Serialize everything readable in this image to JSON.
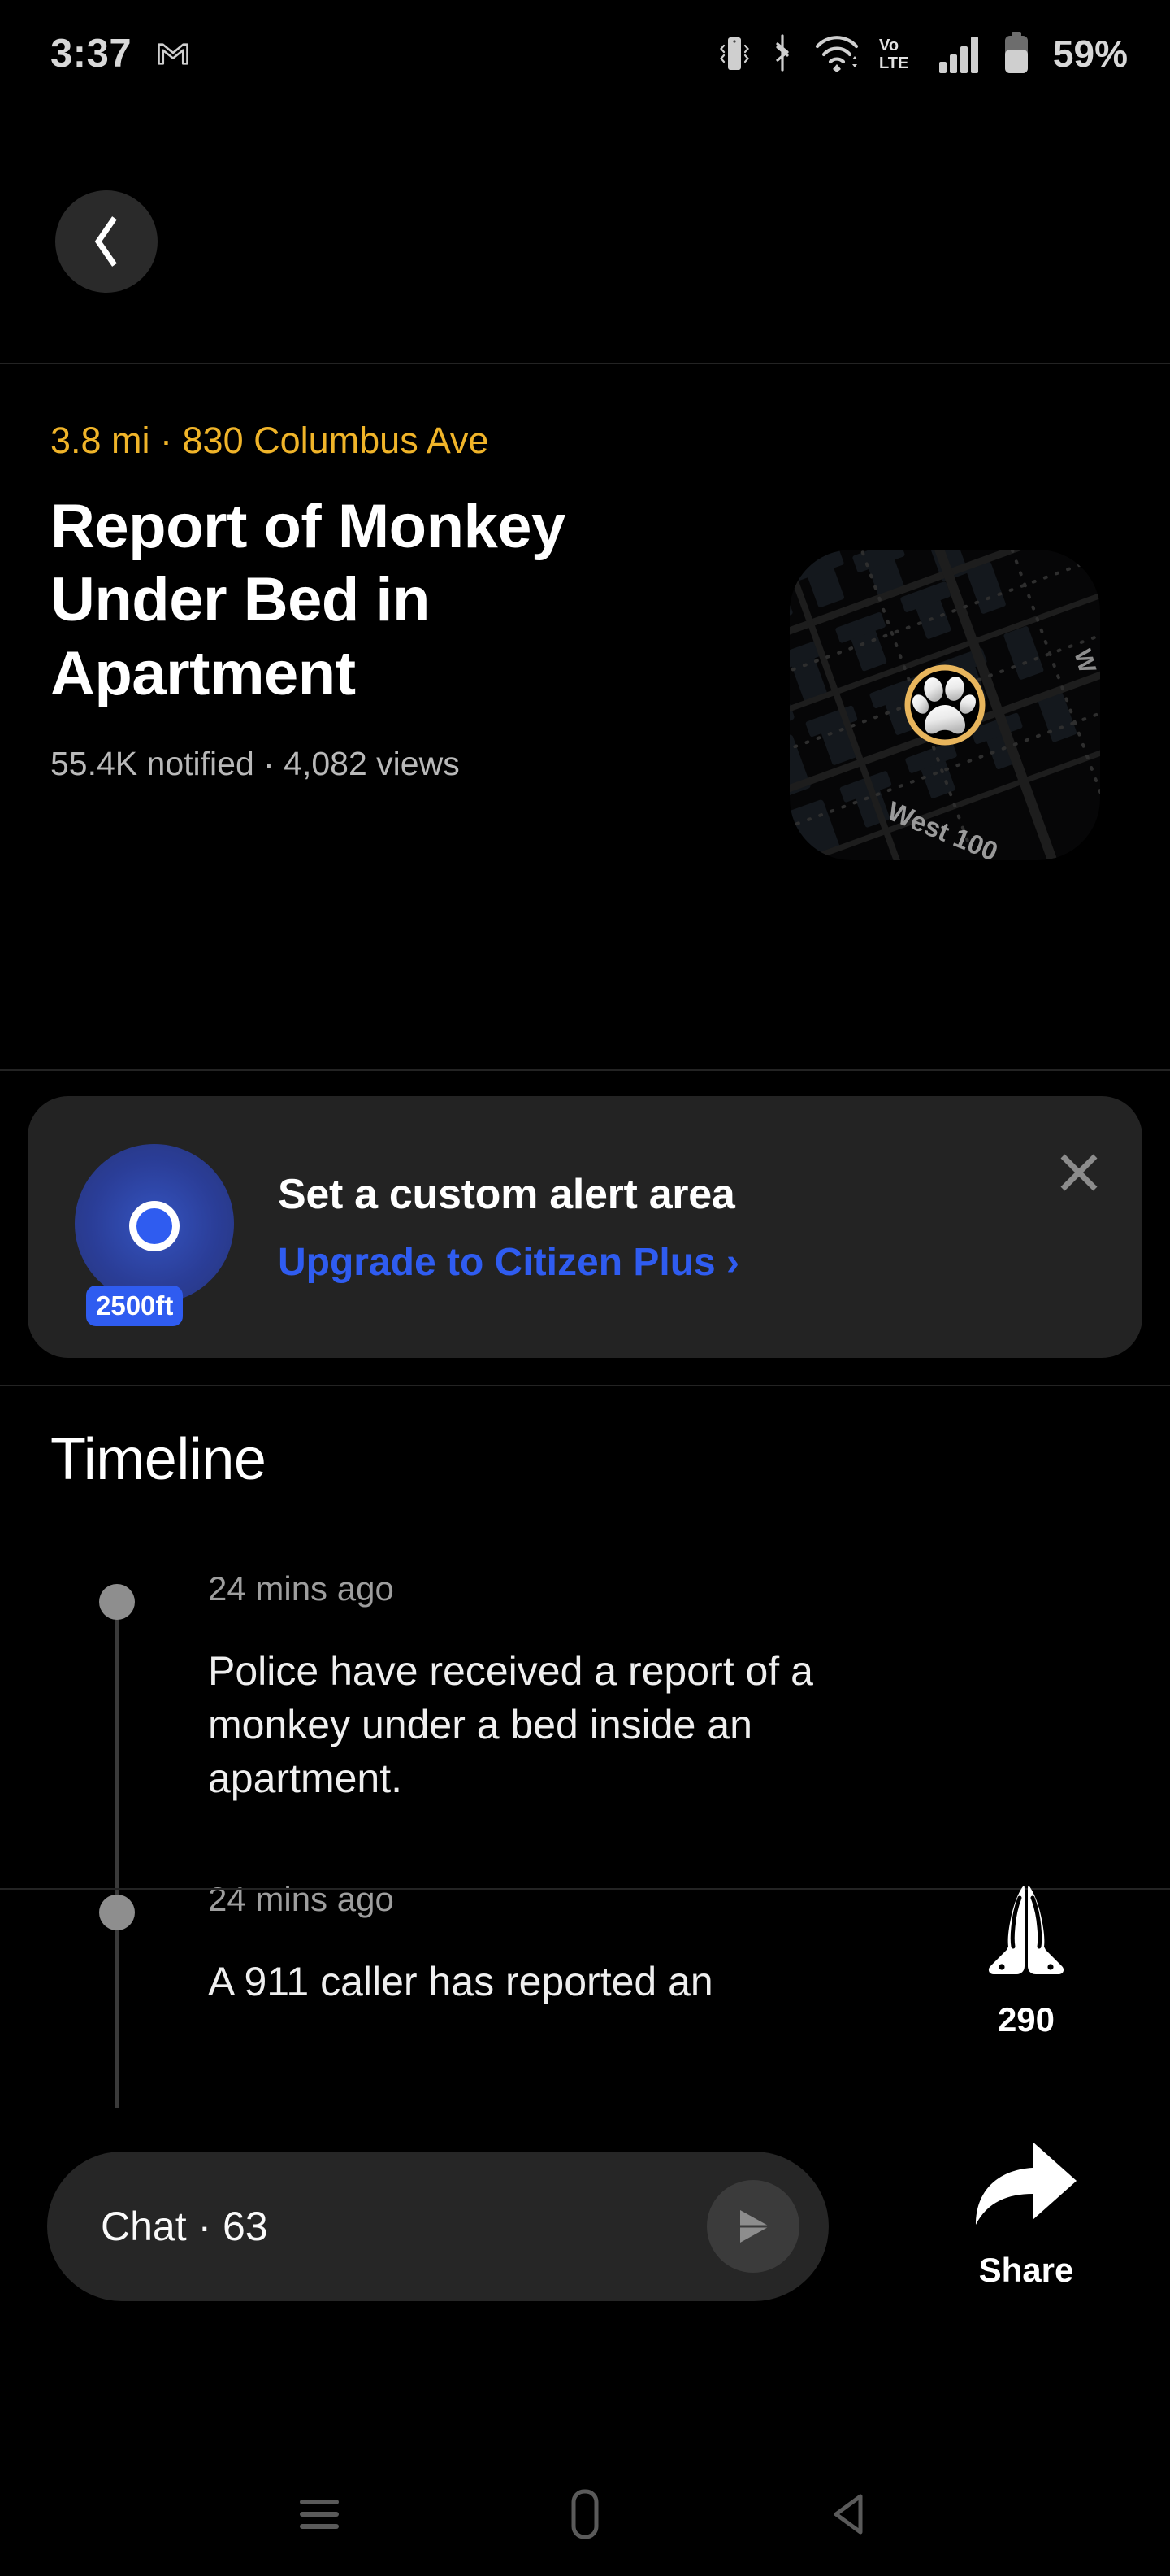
{
  "status_bar": {
    "time": "3:37",
    "battery_percent": "59%",
    "icons": [
      "gmail-icon",
      "vibrate-icon",
      "bluetooth-icon",
      "wifi-icon",
      "volte-icon",
      "cellular-signal-icon",
      "battery-icon"
    ]
  },
  "header": {
    "back_label": "Back"
  },
  "incident": {
    "address": "3.8 mi · 830 Columbus Ave",
    "title": "Report of Monkey Under Bed in Apartment",
    "meta": "55.4K notified · 4,082 views",
    "map": {
      "street_label": "West 100",
      "street_label_secondary": "W",
      "marker_icon": "paw-print-icon",
      "marker_ring_color": "#e8b55c"
    }
  },
  "promo": {
    "title": "Set a custom alert area",
    "link": "Upgrade to Citizen Plus ›",
    "radius_badge": "2500ft",
    "close_icon": "close-icon",
    "accent_color": "#2f5cf0"
  },
  "timeline": {
    "heading": "Timeline",
    "entries": [
      {
        "time": "24 mins ago",
        "text": "Police have received a report of a monkey under a bed inside an apartment."
      },
      {
        "time": "24 mins ago",
        "text": "A 911 caller has reported an"
      }
    ]
  },
  "actions": {
    "pray": {
      "icon": "praying-hands-icon",
      "count": "290"
    },
    "share": {
      "icon": "share-arrow-icon",
      "label": "Share"
    }
  },
  "chat": {
    "placeholder": "Chat · 63",
    "send_icon": "send-icon"
  },
  "nav_bar": {
    "recents": "recents-icon",
    "home": "home-icon",
    "back": "back-icon"
  },
  "colors": {
    "background": "#000000",
    "address_amber": "#f0b429",
    "link_blue": "#2f5cf0",
    "surface": "#232323"
  }
}
